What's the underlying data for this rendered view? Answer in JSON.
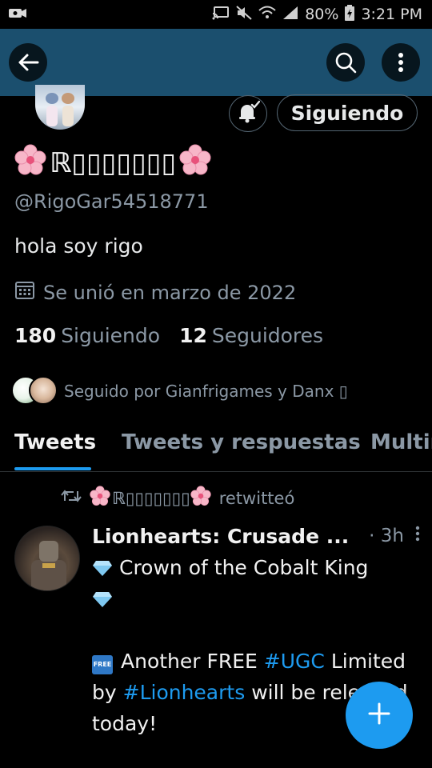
{
  "status_bar": {
    "battery": "80%",
    "time": "3:21 PM"
  },
  "profile": {
    "display_name": "ℝ▯▯▯▯▯▯▯",
    "handle": "@RigoGar54518771",
    "bio": "hola soy rigo",
    "joined": "Se unió en marzo de 2022",
    "following_count": "180",
    "following_label": "Siguiendo",
    "followers_count": "12",
    "followers_label": "Seguidores",
    "followed_by": "Seguido por Gianfrigames y Danx ▯",
    "follow_button": "Siguiendo"
  },
  "tabs": [
    {
      "label": "Tweets",
      "active": true
    },
    {
      "label": "Tweets y respuestas",
      "active": false
    },
    {
      "label": "Multir",
      "active": false
    }
  ],
  "tweet": {
    "retweeter": "ℝ▯▯▯▯▯▯▯",
    "retweet_label": "retwitteó",
    "author": "Lionhearts: Crusade ...",
    "time": "· 3h",
    "line1": "Crown of the Cobalt King",
    "line2_prefix": "Another FREE",
    "hashtag1": "#UGC",
    "line2_mid": "Limited by",
    "hashtag2": "#Lionhearts",
    "line2_suffix": "will be released today!"
  },
  "icons": {
    "back": "arrow-left-icon",
    "search": "search-icon",
    "more": "more-vertical-icon",
    "bell": "notification-bell-icon",
    "calendar": "calendar-icon",
    "retweet": "retweet-icon",
    "compose": "plus-icon"
  },
  "colors": {
    "header": "#1b4f6e",
    "accent": "#1d9bf0",
    "background": "#000000"
  }
}
